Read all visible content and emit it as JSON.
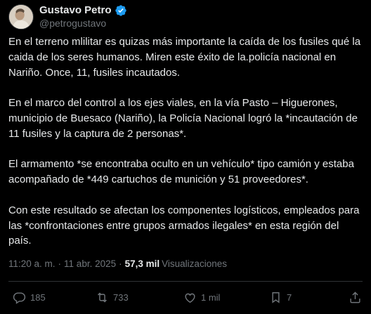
{
  "author": {
    "display_name": "Gustavo Petro",
    "handle": "@petrogustavo",
    "verified_color": "#1d9bf0"
  },
  "tweet": {
    "paragraphs": [
      "En el terreno mlilitar es quizas más importante la caída de los fusiles qué la caida de los seres humanos. Miren este éxito de la.policía nacional en Nariño. Once, 11,  fusiles incautados.",
      "En el marco del control a los ejes viales, en la vía Pasto – Higuerones, municipio de Buesaco (Nariño), la Policía Nacional logró la *incautación de 11 fusiles y la captura de 2 personas*.",
      "El armamento *se encontraba oculto en un vehículo* tipo camión y estaba acompañado de *449 cartuchos de munición y 51 proveedores*.",
      "Con este resultado se afectan los componentes logísticos, empleados para las *confrontaciones entre grupos armados ilegales* en esta región del país."
    ]
  },
  "meta": {
    "time": "11:20 a. m.",
    "separator": "·",
    "date": "11 abr. 2025",
    "views_count": "57,3 mil",
    "views_label": "Visualizaciones"
  },
  "actions": {
    "replies": "185",
    "retweets": "733",
    "likes": "1 mil",
    "bookmarks": "7",
    "reply_icon": "reply-icon",
    "retweet_icon": "retweet-icon",
    "like_icon": "heart-icon",
    "bookmark_icon": "bookmark-icon",
    "share_icon": "share-icon"
  },
  "colors": {
    "background": "#000000",
    "text": "#e7e9ea",
    "muted": "#71767b",
    "divider": "#2f3336"
  }
}
